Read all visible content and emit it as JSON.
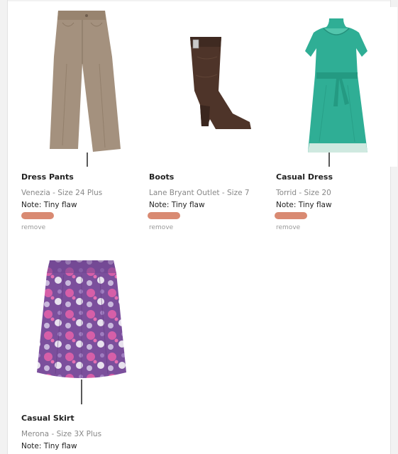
{
  "items": [
    {
      "title": "Dress Pants",
      "subtitle": "Venezia - Size 24 Plus",
      "note": "Note: Tiny flaw",
      "remove": "remove",
      "color": "#a4917e"
    },
    {
      "title": "Boots",
      "subtitle": "Lane Bryant Outlet - Size 7",
      "note": "Note: Tiny flaw",
      "remove": "remove",
      "color": "#4e3429"
    },
    {
      "title": "Casual Dress",
      "subtitle": "Torrid - Size 20",
      "note": "Note: Tiny flaw",
      "remove": "remove",
      "color": "#2fae95"
    },
    {
      "title": "Casual Skirt",
      "subtitle": "Merona - Size 3X Plus",
      "note": "Note: Tiny flaw"
    }
  ],
  "redaction_color": "#d98a72"
}
